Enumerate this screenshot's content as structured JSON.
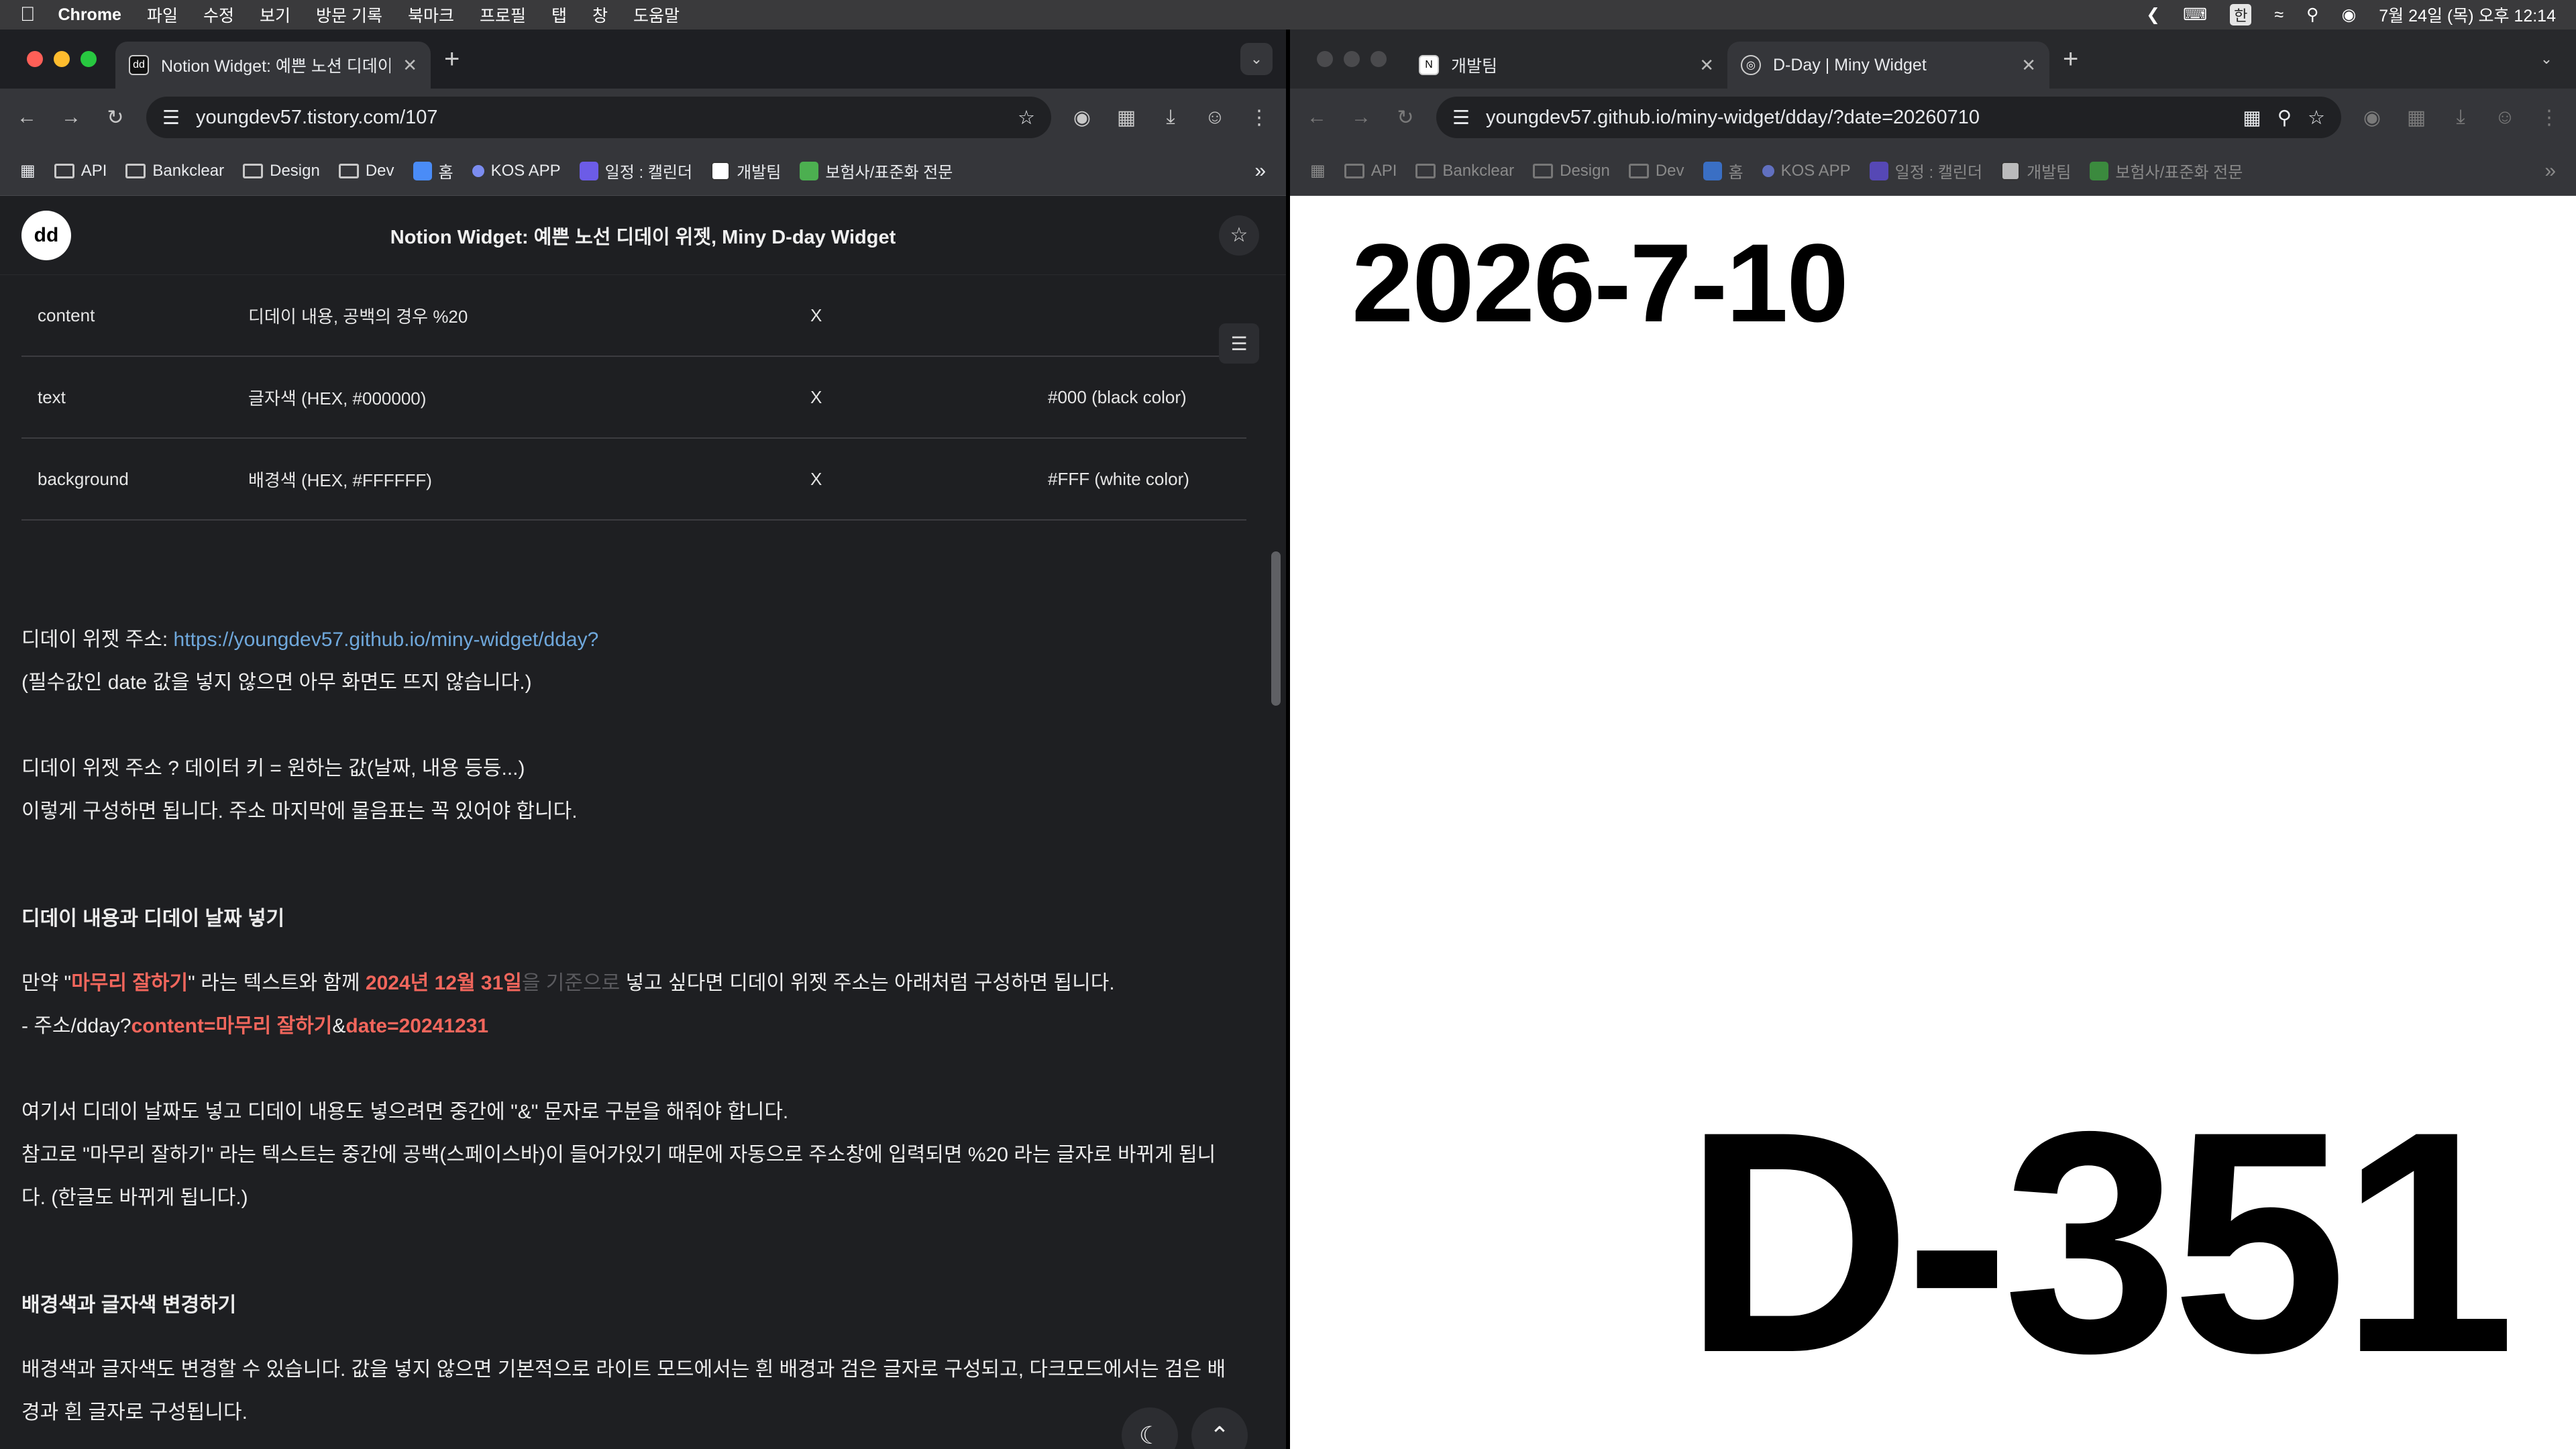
{
  "menubar": {
    "app": "Chrome",
    "menus": [
      "파일",
      "수정",
      "보기",
      "방문 기록",
      "북마크",
      "프로필",
      "탭",
      "창",
      "도움말"
    ],
    "ime": "한",
    "clock": "7월 24일 (목) 오후 12:14"
  },
  "left_window": {
    "tab": {
      "title": "Notion Widget: 예쁜 노션 디데이 위젯"
    },
    "url": "youngdev57.tistory.com/107",
    "bookmarks": [
      "API",
      "Bankclear",
      "Design",
      "Dev",
      "홈",
      "KOS APP",
      "일정 : 캘린더",
      "개발팀",
      "보험사/표준화 전문"
    ],
    "site": {
      "title": "Notion Widget: 예쁜 노선 디데이 위젯, Miny D-day Widget",
      "logo_text": "dd"
    },
    "table_rows": [
      {
        "key": "content",
        "desc": "디데이 내용, 공백의 경우 %20",
        "required": "X",
        "default": ""
      },
      {
        "key": "text",
        "desc": "글자색 (HEX, #000000)",
        "required": "X",
        "default": "#000 (black color)"
      },
      {
        "key": "background",
        "desc": "배경색 (HEX, #FFFFFF)",
        "required": "X",
        "default": "#FFF (white color)"
      }
    ],
    "article": {
      "addr_label": "디데이 위젯 주소: ",
      "addr_link": "https://youngdev57.github.io/miny-widget/dday?",
      "addr_note": "(필수값인 date 값을 넣지 않으면 아무 화면도 뜨지 않습니다.)",
      "format_line": "디데이 위젯 주소 ? 데이터 키 = 원하는 값(날짜, 내용 등등...)",
      "format_note": "이렇게 구성하면 됩니다. 주소 마지막에 물음표는 꼭 있어야 합니다.",
      "h_content_date": "디데이 내용과 디데이 날짜 넣기",
      "ex_1a": "만약 \"",
      "ex_1b": "마무리 잘하기",
      "ex_1c": "\" 라는 텍스트와 함께 ",
      "ex_1d": "2024년 12월 31일",
      "ex_1e": "을 기준으로",
      "ex_1f": " 넣고 싶다면 디데이 위젯 주소는 아래처럼 구성하면 됩니다.",
      "ex_2a": "- 주소/dday?",
      "ex_2b": "content=마무리 잘하기",
      "ex_2c": "&",
      "ex_2d": "date=20241231",
      "amp_line": "여기서 디데이 날짜도 넣고 디데이 내용도 넣으려면 중간에 \"&\" 문자로 구분을 해줘야 합니다.",
      "space_line1": "참고로 \"마무리 잘하기\" 라는 텍스트는 중간에 공백(스페이스바)이 들어가있기 때문에 자동으로 주소창에 입력되면 %20 라는 글자로 바뀌게 됩니",
      "space_line2": "다. (한글도 바뀌게 됩니다.)",
      "h_colors": "배경색과 글자색 변경하기",
      "color_line1": "배경색과 글자색도 변경할 수 있습니다. 값을 넣지 않으면 기본적으로 라이트 모드에서는 흰 배경과 검은 글자로 구성되고, 다크모드에서는 검은 배",
      "color_line2": "경과 흰 글자로 구성됩니다."
    }
  },
  "right_window": {
    "tabs": [
      {
        "title": "개발팀"
      },
      {
        "title": "D-Day | Miny Widget"
      }
    ],
    "url": "youngdev57.github.io/miny-widget/dday/?date=20260710",
    "bookmarks": [
      "API",
      "Bankclear",
      "Design",
      "Dev",
      "홈",
      "KOS APP",
      "일정 : 캘린더",
      "개발팀",
      "보험사/표준화 전문"
    ],
    "date": "2026-7-10",
    "dday": "D-351"
  },
  "colors": {
    "highlight": "#f2665c",
    "link": "#6fa8dc"
  }
}
